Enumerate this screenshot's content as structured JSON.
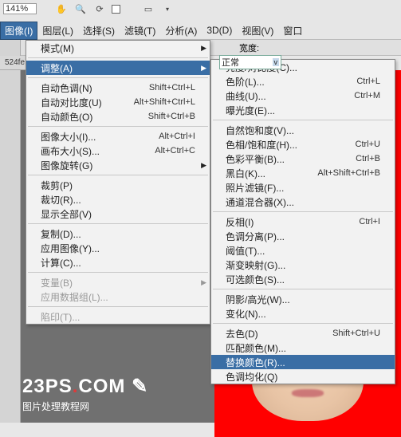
{
  "toolbar": {
    "zoom": "141%"
  },
  "menubar": {
    "items": [
      "图像(I)",
      "图层(L)",
      "选择(S)",
      "滤镜(T)",
      "分析(A)",
      "3D(D)",
      "视图(V)",
      "窗口"
    ]
  },
  "option_bar": {
    "normal_label": "正常",
    "width_label": "宽度:"
  },
  "tab_label": "524fe",
  "main_menu": {
    "items": [
      {
        "label": "模式(M)",
        "arrow": true
      },
      {
        "label": "调整(A)",
        "arrow": true,
        "selected": true
      },
      {
        "label": "自动色调(N)",
        "shortcut": "Shift+Ctrl+L"
      },
      {
        "label": "自动对比度(U)",
        "shortcut": "Alt+Shift+Ctrl+L"
      },
      {
        "label": "自动颜色(O)",
        "shortcut": "Shift+Ctrl+B"
      },
      {
        "label": "图像大小(I)...",
        "shortcut": "Alt+Ctrl+I"
      },
      {
        "label": "画布大小(S)...",
        "shortcut": "Alt+Ctrl+C"
      },
      {
        "label": "图像旋转(G)",
        "arrow": true
      },
      {
        "label": "裁剪(P)"
      },
      {
        "label": "裁切(R)..."
      },
      {
        "label": "显示全部(V)"
      },
      {
        "label": "复制(D)..."
      },
      {
        "label": "应用图像(Y)..."
      },
      {
        "label": "计算(C)..."
      },
      {
        "label": "变量(B)",
        "arrow": true,
        "dimmed": true
      },
      {
        "label": "应用数据组(L)...",
        "dimmed": true
      },
      {
        "label": "陷印(T)...",
        "dimmed": true
      }
    ],
    "separators_after": [
      0,
      1,
      4,
      7,
      10,
      13,
      15
    ]
  },
  "sub_menu": {
    "items": [
      {
        "label": "亮度/对比度(C)..."
      },
      {
        "label": "色阶(L)...",
        "shortcut": "Ctrl+L"
      },
      {
        "label": "曲线(U)...",
        "shortcut": "Ctrl+M"
      },
      {
        "label": "曝光度(E)..."
      },
      {
        "label": "自然饱和度(V)..."
      },
      {
        "label": "色相/饱和度(H)...",
        "shortcut": "Ctrl+U"
      },
      {
        "label": "色彩平衡(B)...",
        "shortcut": "Ctrl+B"
      },
      {
        "label": "黑白(K)...",
        "shortcut": "Alt+Shift+Ctrl+B"
      },
      {
        "label": "照片滤镜(F)..."
      },
      {
        "label": "通道混合器(X)..."
      },
      {
        "label": "反相(I)",
        "shortcut": "Ctrl+I"
      },
      {
        "label": "色调分离(P)..."
      },
      {
        "label": "阈值(T)..."
      },
      {
        "label": "渐变映射(G)..."
      },
      {
        "label": "可选颜色(S)..."
      },
      {
        "label": "阴影/高光(W)..."
      },
      {
        "label": "变化(N)..."
      },
      {
        "label": "去色(D)",
        "shortcut": "Shift+Ctrl+U"
      },
      {
        "label": "匹配颜色(M)..."
      },
      {
        "label": "替换颜色(R)...",
        "selected": true
      },
      {
        "label": "色调均化(Q)"
      }
    ],
    "separators_after": [
      3,
      9,
      14,
      16
    ]
  },
  "logo": {
    "text1": "23PS",
    "dot": ".",
    "text2": "COM",
    "sub": "图片处理教程网"
  }
}
